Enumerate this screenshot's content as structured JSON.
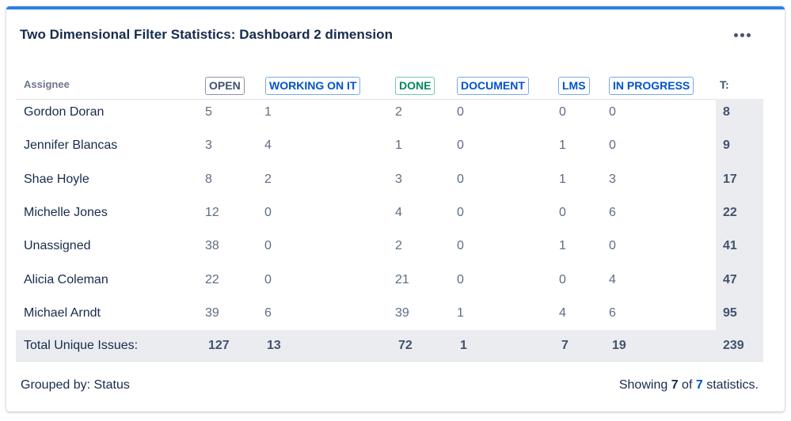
{
  "gadget": {
    "title": "Two Dimensional Filter Statistics: Dashboard 2 dimension",
    "menu_icon": "more-horizontal-icon"
  },
  "table": {
    "assignee_header": "Assignee",
    "statuses": [
      {
        "label": "OPEN",
        "style": "gray"
      },
      {
        "label": "WORKING ON IT",
        "style": "blue"
      },
      {
        "label": "DONE",
        "style": "green"
      },
      {
        "label": "DOCUMENT",
        "style": "blue"
      },
      {
        "label": "LMS",
        "style": "blue"
      },
      {
        "label": "IN PROGRESS",
        "style": "blue"
      }
    ],
    "total_header": "T:",
    "rows": [
      {
        "assignee": "Gordon Doran",
        "values": [
          "5",
          "1",
          "2",
          "0",
          "0",
          "0"
        ],
        "total": "8"
      },
      {
        "assignee": "Jennifer Blancas",
        "values": [
          "3",
          "4",
          "1",
          "0",
          "1",
          "0"
        ],
        "total": "9"
      },
      {
        "assignee": "Shae Hoyle",
        "values": [
          "8",
          "2",
          "3",
          "0",
          "1",
          "3"
        ],
        "total": "17"
      },
      {
        "assignee": "Michelle Jones",
        "values": [
          "12",
          "0",
          "4",
          "0",
          "0",
          "6"
        ],
        "total": "22"
      },
      {
        "assignee": "Unassigned",
        "values": [
          "38",
          "0",
          "2",
          "0",
          "1",
          "0"
        ],
        "total": "41"
      },
      {
        "assignee": "Alicia Coleman",
        "values": [
          "22",
          "0",
          "21",
          "0",
          "0",
          "4"
        ],
        "total": "47"
      },
      {
        "assignee": "Michael Arndt",
        "values": [
          "39",
          "6",
          "39",
          "1",
          "4",
          "6"
        ],
        "total": "95"
      }
    ],
    "totals": {
      "label": "Total Unique Issues:",
      "values": [
        "127",
        "13",
        "72",
        "1",
        "7",
        "19"
      ],
      "grand_total": "239"
    }
  },
  "footer": {
    "grouped_by": "Grouped by: Status",
    "showing_prefix": "Showing",
    "shown_count": "7",
    "of_text": "of",
    "total_count": "7",
    "showing_suffix": "statistics."
  },
  "colors": {
    "accent_bar": "#2f7ee8",
    "link_blue": "#0052cc",
    "done_green": "#00875a",
    "total_bg": "#ebecf0"
  }
}
